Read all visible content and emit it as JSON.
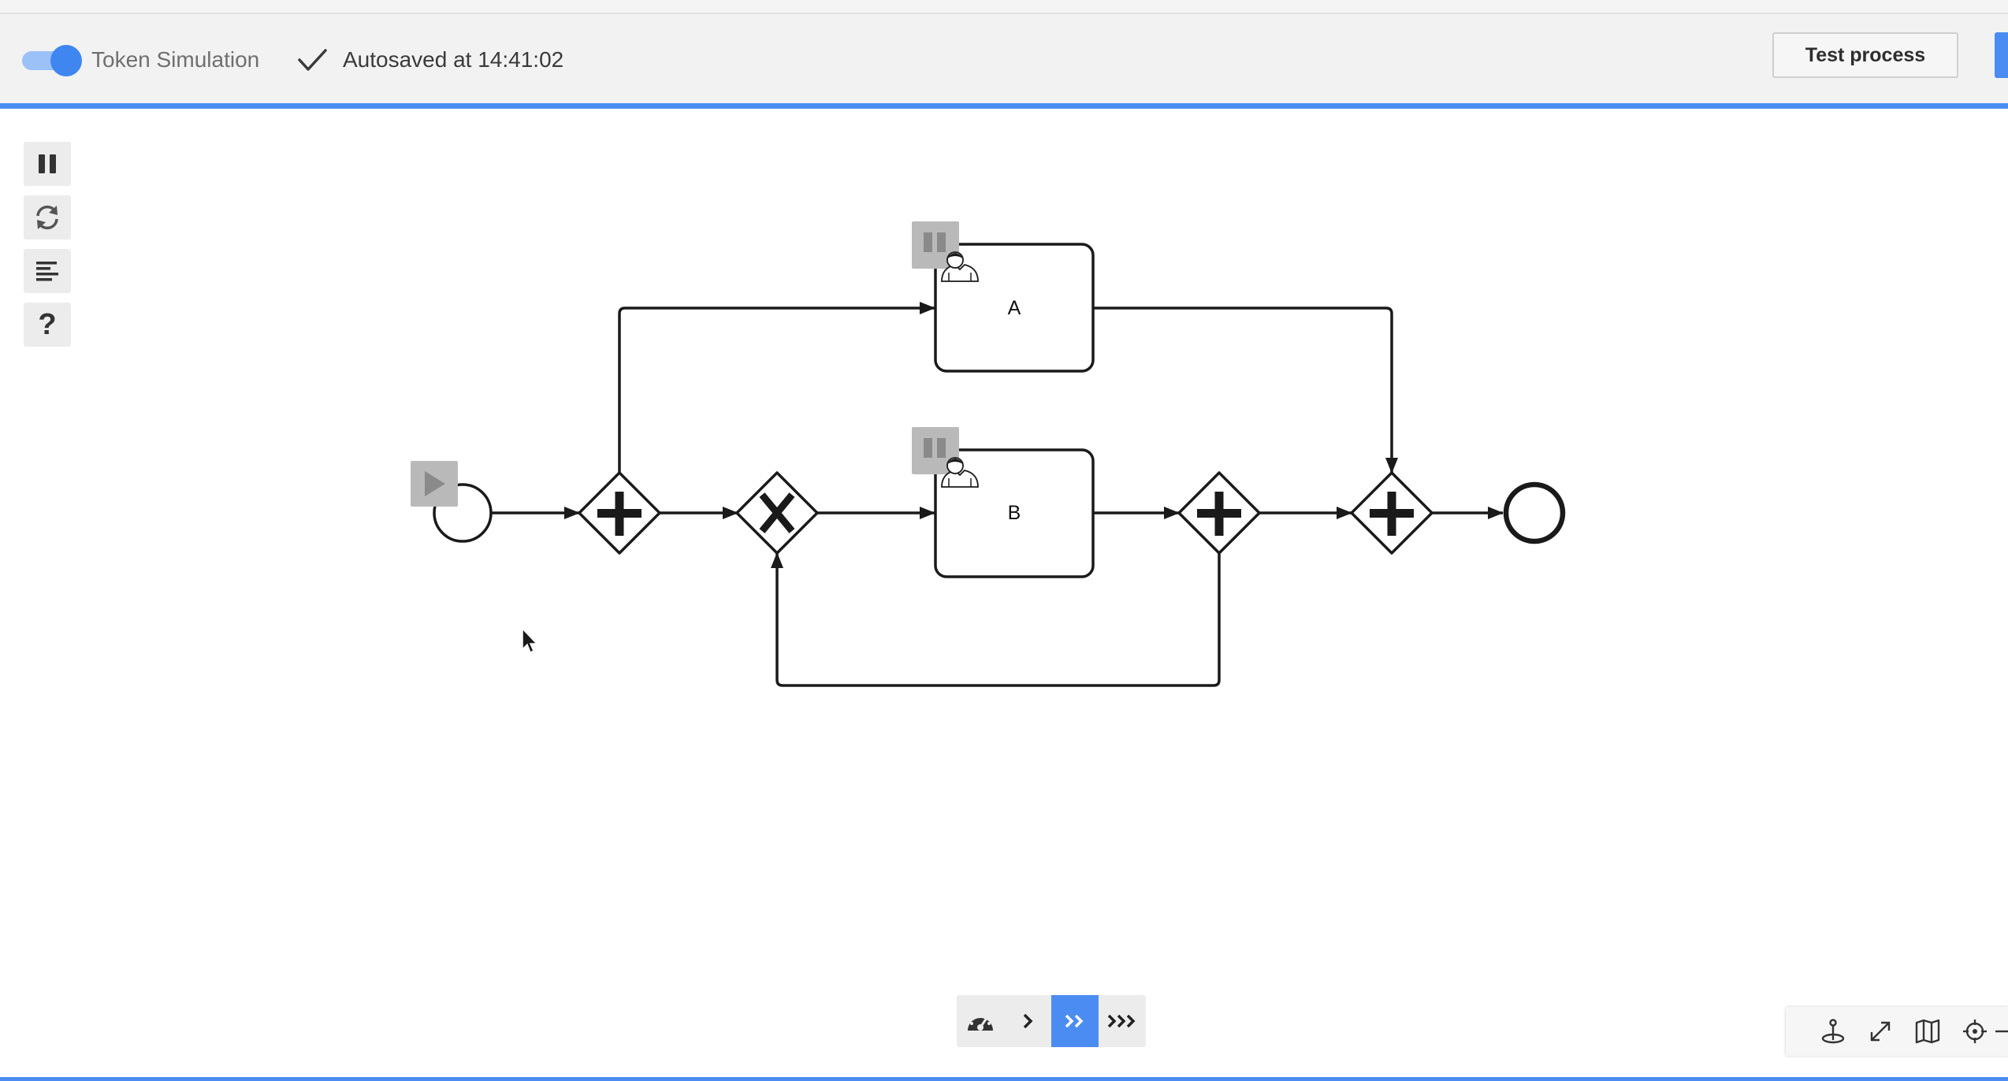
{
  "header": {
    "toggle_label": "Token Simulation",
    "toggle_on": true,
    "autosave_text": "Autosaved at 14:41:02",
    "test_button": "Test process"
  },
  "palette": {
    "items": [
      "pause-icon",
      "reset-icon",
      "log-icon",
      "help-icon"
    ],
    "help_glyph": "?"
  },
  "diagram": {
    "tasks": [
      {
        "label": "A",
        "icon": "user-task-icon"
      },
      {
        "label": "B",
        "icon": "user-task-icon"
      }
    ],
    "gateways": [
      {
        "type": "parallel",
        "glyph": "+"
      },
      {
        "type": "exclusive",
        "glyph": "X"
      },
      {
        "type": "parallel",
        "glyph": "+"
      },
      {
        "type": "parallel",
        "glyph": "+"
      }
    ],
    "events": [
      "start-event",
      "end-event"
    ],
    "token_controls": [
      "play-icon",
      "pause-icon",
      "pause-icon"
    ]
  },
  "speed_control": {
    "items": [
      "speed-gauge-icon",
      "speed-1x-icon",
      "speed-2x-icon",
      "speed-3x-icon"
    ],
    "active_index": 2
  },
  "navigation": {
    "items": [
      "anchor-icon",
      "fullscreen-icon",
      "map-icon",
      "locate-icon",
      "zoom-out-icon"
    ]
  },
  "colors": {
    "accent": "#4b8cf2",
    "toggle_knob": "#3f86f1",
    "toggle_track": "#9cc0f8",
    "token_control": "#b9b9b9",
    "stroke": "#1a1a1a"
  }
}
